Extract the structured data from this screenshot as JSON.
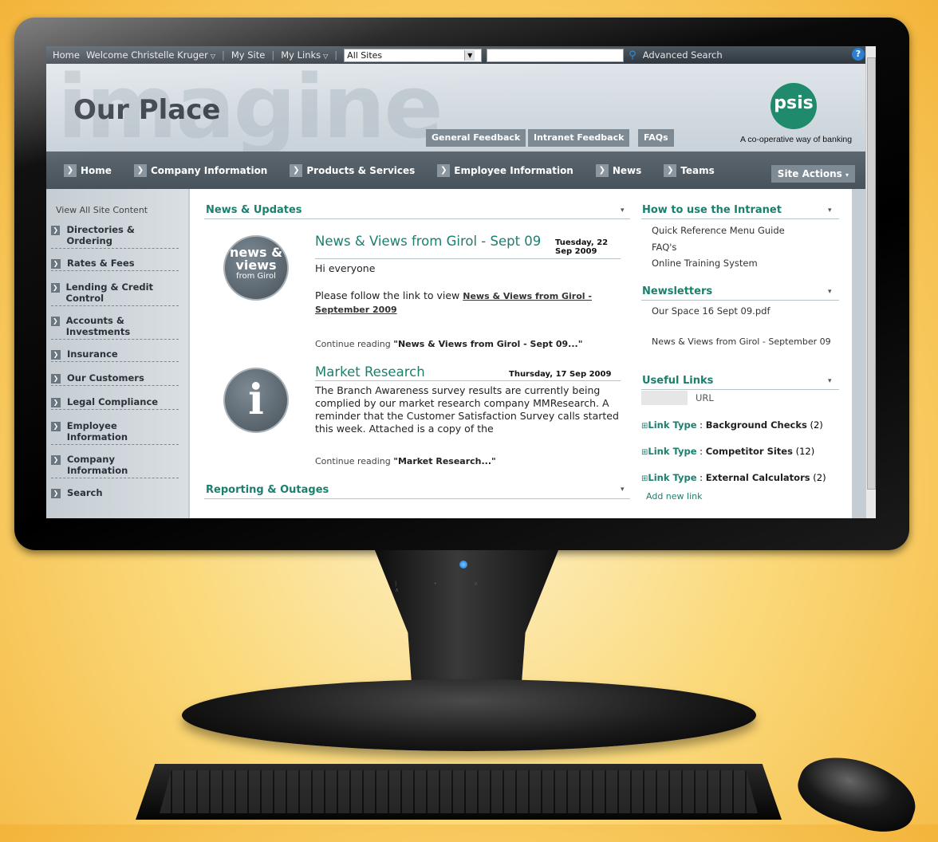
{
  "topbar": {
    "home": "Home",
    "welcome": "Welcome Christelle Kruger",
    "my_site": "My Site",
    "my_links": "My Links",
    "scope": "All Sites",
    "advanced_search": "Advanced Search",
    "help": "?"
  },
  "header": {
    "watermark": "imagine",
    "site_title": "Our Place",
    "buttons": [
      "General Feedback",
      "Intranet Feedback",
      "FAQs"
    ],
    "logo_text": "psis",
    "tagline": "A co-operative way of banking"
  },
  "nav": {
    "items": [
      "Home",
      "Company Information",
      "Products & Services",
      "Employee Information",
      "News",
      "Teams"
    ],
    "site_actions": "Site Actions"
  },
  "left_nav": {
    "view_all": "View All Site Content",
    "items": [
      "Directories & Ordering",
      "Rates & Fees",
      "Lending & Credit Control",
      "Accounts & Investments",
      "Insurance",
      "Our Customers",
      "Legal Compliance",
      "Employee Information",
      "Company Information",
      "Search"
    ]
  },
  "news": {
    "title": "News & Updates",
    "posts": [
      {
        "icon_text": [
          "news &",
          "views",
          "from Girol"
        ],
        "title": "News & Views from Girol - Sept 09",
        "date": "Tuesday, 22 Sep 2009",
        "greeting": "Hi everyone",
        "body": "Please follow the link to view",
        "link": "News & Views from Girol - September 2009",
        "continue_prefix": "Continue reading",
        "continue_title": "\"News & Views from Girol - Sept 09...\""
      },
      {
        "icon_text": [
          "i"
        ],
        "title": "Market Research",
        "date": "Thursday, 17 Sep 2009",
        "body": "The Branch Awareness survey results are currently being complied by our market research company MMResearch. A reminder that the Customer Satisfaction Survey calls started this week. Attached is a copy of the",
        "continue_prefix": "Continue reading",
        "continue_title": "\"Market Research...\""
      }
    ]
  },
  "reporting": {
    "title": "Reporting & Outages"
  },
  "how_to": {
    "title": "How to use the Intranet",
    "links": [
      "Quick Reference Menu Guide",
      "FAQ's",
      "Online Training System"
    ]
  },
  "newsletters": {
    "title": "Newsletters",
    "links": [
      "Our Space 16 Sept 09.pdf",
      "News & Views from Girol - September 09"
    ]
  },
  "useful_links": {
    "title": "Useful Links",
    "url_header": "URL",
    "groups": [
      {
        "key": "Link Type",
        "value": "Background Checks",
        "count": "(2)"
      },
      {
        "key": "Link Type",
        "value": "Competitor Sites",
        "count": "(12)"
      },
      {
        "key": "Link Type",
        "value": "External Calculators",
        "count": "(2)"
      }
    ],
    "add_new": "Add new link"
  }
}
